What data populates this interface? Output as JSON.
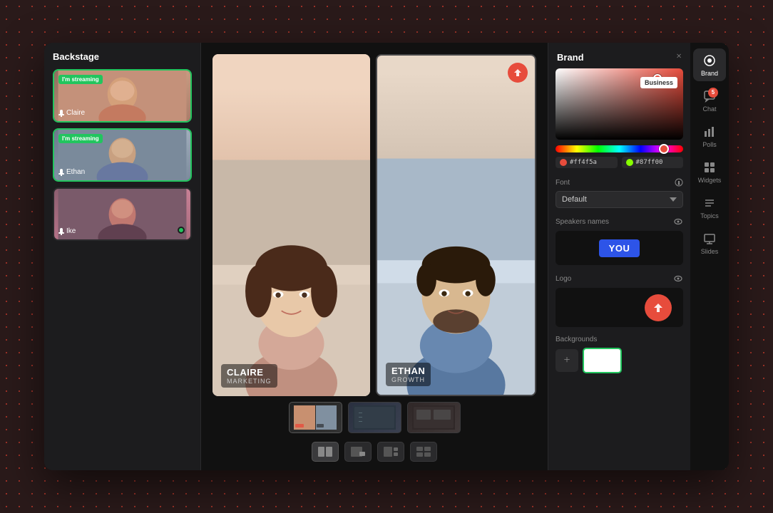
{
  "window": {
    "title": "Backstage"
  },
  "backstage": {
    "title": "Backstage",
    "guests": [
      {
        "name": "Claire",
        "streaming": true,
        "badge": "I'm streaming",
        "active": true
      },
      {
        "name": "Ethan",
        "streaming": true,
        "badge": "I'm streaming",
        "active": true
      },
      {
        "name": "Ike",
        "streaming": false,
        "active": false
      }
    ]
  },
  "stage": {
    "speakers": [
      {
        "name": "CLAIRE",
        "role": "MARKETING"
      },
      {
        "name": "ETHAN",
        "role": "GROWTH"
      }
    ]
  },
  "brand": {
    "title": "Brand",
    "close_icon": "×",
    "color_hex_1": "#ff4f5a",
    "color_hex_2": "#87ff00",
    "font_section": "Font",
    "font_default": "Default",
    "speakers_names_section": "Speakers names",
    "you_label": "YOU",
    "logo_section": "Logo",
    "backgrounds_section": "Backgrounds",
    "text_field_value": "Business"
  },
  "nav": {
    "items": [
      {
        "label": "Brand",
        "active": true
      },
      {
        "label": "Chat",
        "active": false,
        "badge": null
      },
      {
        "label": "Polls",
        "active": false
      },
      {
        "label": "Widgets",
        "active": false
      },
      {
        "label": "Topics",
        "active": false
      },
      {
        "label": "Slides",
        "active": false
      }
    ],
    "chat_badge": "5"
  },
  "layout_controls": {
    "options": [
      "two-column",
      "picture-in-picture",
      "single-left",
      "quad"
    ]
  }
}
